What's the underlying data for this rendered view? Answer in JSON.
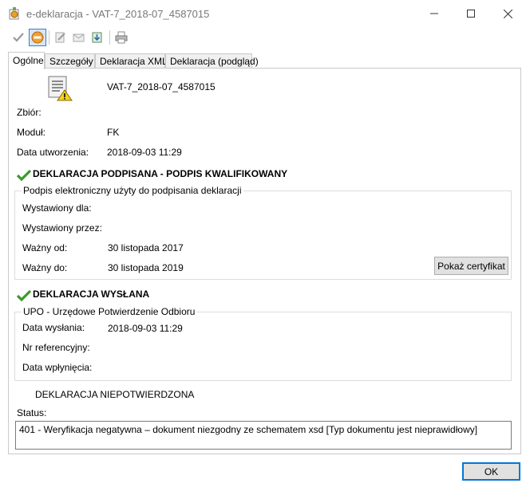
{
  "window": {
    "title": "e-deklaracja - VAT-7_2018-07_4587015"
  },
  "toolbar": {
    "buttons": [
      {
        "icon": "check-icon"
      },
      {
        "icon": "cancel-circle-icon"
      },
      {
        "icon": "sign-document-icon"
      },
      {
        "icon": "send-envelope-icon"
      },
      {
        "icon": "download-upo-icon"
      },
      {
        "icon": "print-icon"
      }
    ]
  },
  "tabs": [
    "Ogólne",
    "Szczegóły",
    "Deklaracja XML",
    "Deklaracja (podgląd)"
  ],
  "general": {
    "document_name": "VAT-7_2018-07_4587015",
    "zbior_label": "Zbiór:",
    "zbior_value": "",
    "modul_label": "Moduł:",
    "modul_value": "FK",
    "data_utworzenia_label": "Data utworzenia:",
    "data_utworzenia_value": "2018-09-03 11:29"
  },
  "signature": {
    "heading": "DEKLARACJA PODPISANA - PODPIS KWALIFIKOWANY",
    "group_title": "Podpis elektroniczny użyty do podpisania deklaracji",
    "wystawiony_dla_label": "Wystawiony dla:",
    "wystawiony_dla_value": "",
    "wystawiony_przez_label": "Wystawiony przez:",
    "wystawiony_przez_value": "",
    "wazny_od_label": "Ważny od:",
    "wazny_od_value": "30 listopada 2017",
    "wazny_do_label": "Ważny do:",
    "wazny_do_value": "30 listopada 2019",
    "show_cert_button": "Pokaż certyfikat"
  },
  "sending": {
    "heading": "DEKLARACJA WYSŁANA",
    "group_title": "UPO - Urzędowe Potwierdzenie Odbioru",
    "data_wyslania_label": "Data wysłania:",
    "data_wyslania_value": "2018-09-03 11:29",
    "nr_referencyjny_label": "Nr referencyjny:",
    "nr_referencyjny_value": "",
    "data_wplyniecia_label": "Data wpłynięcia:",
    "data_wplyniecia_value": ""
  },
  "confirmation": {
    "heading": "DEKLARACJA NIEPOTWIERDZONA",
    "status_label": "Status:",
    "status_value": "401 - Weryfikacja negatywna – dokument niezgodny ze schematem xsd  [Typ dokumentu jest nieprawidłowy]"
  },
  "ok_button": "OK",
  "colors": {
    "accent_blue": "#0078d7",
    "check_green": "#3a9a2a",
    "cancel_orange": "#f0a030"
  }
}
